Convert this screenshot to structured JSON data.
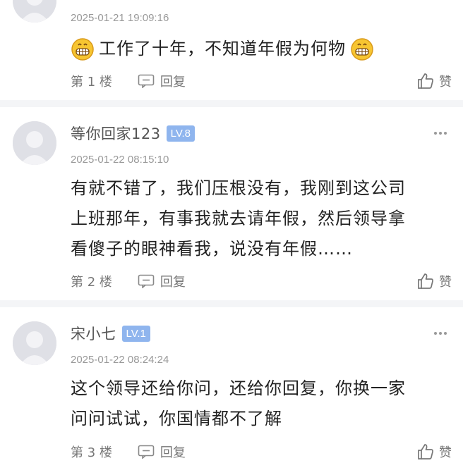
{
  "posts": [
    {
      "timestamp": "2025-01-21 19:09:16",
      "content_lines": [
        "工作了十年，不知道年假为何物"
      ],
      "floor": "第 1 楼",
      "reply_label": "回复",
      "like_label": "赞"
    },
    {
      "username": "等你回家123",
      "level": "LV.8",
      "timestamp": "2025-01-22 08:15:10",
      "content_lines": [
        "有就不错了，我们压根没有，我刚到这公司",
        "上班那年，有事我就去请年假，然后领导拿",
        "看傻子的眼神看我，说没有年假……"
      ],
      "floor": "第 2 楼",
      "reply_label": "回复",
      "like_label": "赞"
    },
    {
      "username": "宋小七",
      "level": "LV.1",
      "timestamp": "2025-01-22 08:24:24",
      "content_lines": [
        "这个领导还给你问，还给你回复，你换一家",
        "问问试试，你国情都不了解"
      ],
      "floor": "第 3 楼",
      "reply_label": "回复",
      "like_label": "赞"
    }
  ],
  "colors": {
    "badge": "#8fb5ee",
    "separator": "#f4f5f7",
    "meta_text": "#999999"
  },
  "icons": [
    "grinning-emoji-icon",
    "reply-icon",
    "thumbs-up-icon",
    "more-icon",
    "avatar-icon"
  ]
}
